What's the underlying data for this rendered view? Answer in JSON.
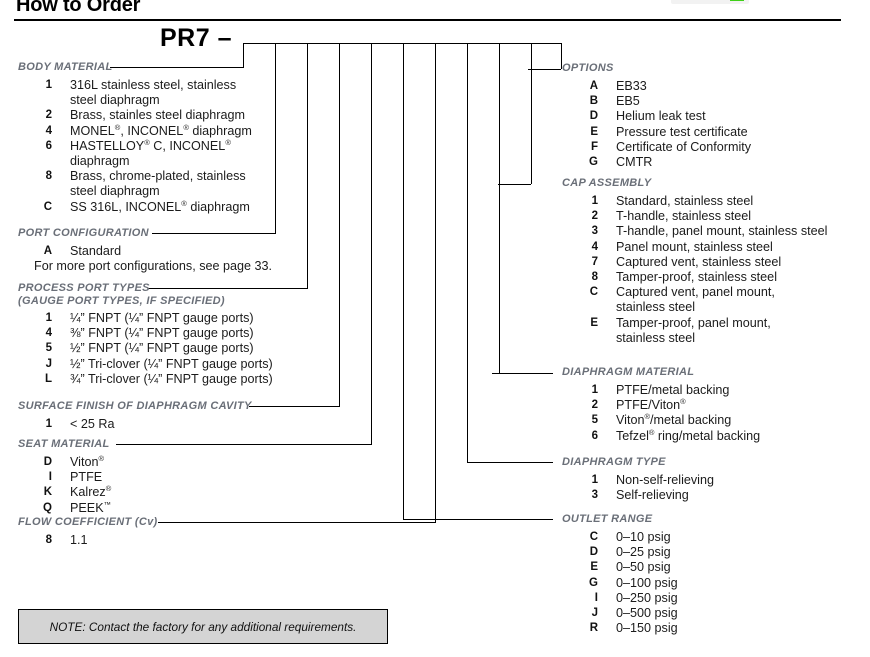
{
  "header": {
    "title": "How to Order",
    "model_prefix": "PR7 –"
  },
  "logo": {
    "accent_color": "#3fd018"
  },
  "note": {
    "text": "NOTE: Contact the factory for any additional requirements."
  },
  "left_sections": [
    {
      "title": "BODY MATERIAL",
      "options": [
        {
          "code": "1",
          "desc": "316L stainless steel, stainless\nsteel diaphragm"
        },
        {
          "code": "2",
          "desc": "Brass, stainles steel diaphragm"
        },
        {
          "code": "4",
          "desc": "MONEL®, INCONEL® diaphragm"
        },
        {
          "code": "6",
          "desc": "HASTELLOY® C, INCONEL®\ndiaphragm"
        },
        {
          "code": "8",
          "desc": "Brass, chrome-plated, stainless\nsteel diaphragm"
        },
        {
          "code": "C",
          "desc": "SS 316L, INCONEL® diaphragm"
        }
      ]
    },
    {
      "title": "PORT CONFIGURATION",
      "options": [
        {
          "code": "A",
          "desc": "Standard"
        }
      ],
      "footnote": "For more port configurations, see page 33."
    },
    {
      "title": "PROCESS PORT TYPES",
      "subtitle": "(GAUGE PORT TYPES, IF SPECIFIED)",
      "options": [
        {
          "code": "1",
          "desc": "¼” FNPT (¼” FNPT gauge ports)"
        },
        {
          "code": "4",
          "desc": "⅜” FNPT (¼” FNPT gauge ports)"
        },
        {
          "code": "5",
          "desc": "½” FNPT (¼” FNPT gauge ports)"
        },
        {
          "code": "J",
          "desc": "½” Tri-clover (¼” FNPT gauge ports)"
        },
        {
          "code": "L",
          "desc": "¾” Tri-clover (¼” FNPT gauge ports)"
        }
      ]
    },
    {
      "title": "SURFACE FINISH OF DIAPHRAGM CAVITY",
      "options": [
        {
          "code": "1",
          "desc": "< 25 Ra"
        }
      ]
    },
    {
      "title": "SEAT MATERIAL",
      "options": [
        {
          "code": "D",
          "desc": "Viton®"
        },
        {
          "code": "I",
          "desc": "PTFE"
        },
        {
          "code": "K",
          "desc": "Kalrez®"
        },
        {
          "code": "Q",
          "desc": "PEEK™"
        }
      ]
    },
    {
      "title": "FLOW COEFFICIENT (Cv)",
      "options": [
        {
          "code": "8",
          "desc": "1.1"
        }
      ]
    }
  ],
  "right_sections": [
    {
      "title": "OPTIONS",
      "options": [
        {
          "code": "A",
          "desc": "EB33"
        },
        {
          "code": "B",
          "desc": "EB5"
        },
        {
          "code": "D",
          "desc": "Helium leak test"
        },
        {
          "code": "E",
          "desc": "Pressure test certificate"
        },
        {
          "code": "F",
          "desc": "Certificate of Conformity"
        },
        {
          "code": "G",
          "desc": "CMTR"
        }
      ]
    },
    {
      "title": "CAP ASSEMBLY",
      "options": [
        {
          "code": "1",
          "desc": "Standard, stainless steel"
        },
        {
          "code": "2",
          "desc": "T-handle, stainless steel"
        },
        {
          "code": "3",
          "desc": "T-handle, panel mount, stainless steel"
        },
        {
          "code": "4",
          "desc": "Panel mount, stainless steel"
        },
        {
          "code": "7",
          "desc": "Captured vent, stainless steel"
        },
        {
          "code": "8",
          "desc": "Tamper-proof, stainless steel"
        },
        {
          "code": "C",
          "desc": "Captured vent, panel mount,\nstainless steel"
        },
        {
          "code": "E",
          "desc": "Tamper-proof, panel mount,\nstainless steel"
        }
      ]
    },
    {
      "title": "DIAPHRAGM MATERIAL",
      "options": [
        {
          "code": "1",
          "desc": "PTFE/metal backing"
        },
        {
          "code": "2",
          "desc": "PTFE/Viton®"
        },
        {
          "code": "5",
          "desc": "Viton®/metal backing"
        },
        {
          "code": "6",
          "desc": "Tefzel® ring/metal backing"
        }
      ]
    },
    {
      "title": "DIAPHRAGM TYPE",
      "options": [
        {
          "code": "1",
          "desc": "Non-self-relieving"
        },
        {
          "code": "3",
          "desc": "Self-relieving"
        }
      ]
    },
    {
      "title": "OUTLET RANGE",
      "options": [
        {
          "code": "C",
          "desc": "0–10 psig"
        },
        {
          "code": "D",
          "desc": "0–25 psig"
        },
        {
          "code": "E",
          "desc": "0–50 psig"
        },
        {
          "code": "G",
          "desc": "0–100 psig"
        },
        {
          "code": "I",
          "desc": "0–250 psig"
        },
        {
          "code": "J",
          "desc": "0–500 psig"
        },
        {
          "code": "R",
          "desc": "0–150 psig"
        }
      ]
    }
  ]
}
